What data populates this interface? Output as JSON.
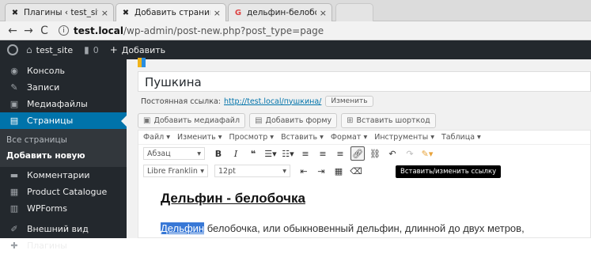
{
  "browser": {
    "tabs": [
      {
        "title": "Плагины ‹ test_site — W",
        "icon": "wordpress-icon",
        "active": false
      },
      {
        "title": "Добавить страницу ‹ te:",
        "icon": "wordpress-icon",
        "active": true
      },
      {
        "title": "дельфин-белобочка - П",
        "icon": "google-icon",
        "active": false
      }
    ],
    "close_glyph": "×",
    "url_host": "test.local",
    "url_path": "/wp-admin/post-new.php?post_type=page"
  },
  "adminbar": {
    "site_name": "test_site",
    "comments_count": "0",
    "add_label": "Добавить"
  },
  "sidebar": {
    "items": [
      {
        "label": "Консоль",
        "icon": "dashboard-icon"
      },
      {
        "label": "Записи",
        "icon": "pin-icon"
      },
      {
        "label": "Медиафайлы",
        "icon": "media-icon"
      },
      {
        "label": "Страницы",
        "icon": "pages-icon",
        "current": true
      }
    ],
    "submenu": [
      {
        "label": "Все страницы"
      },
      {
        "label": "Добавить новую",
        "current": true
      }
    ],
    "items_after": [
      {
        "label": "Комментарии",
        "icon": "comments-icon"
      },
      {
        "label": "Product Catalogue",
        "icon": "catalog-icon"
      },
      {
        "label": "WPForms",
        "icon": "forms-icon"
      },
      {
        "label": "Внешний вид",
        "icon": "brush-icon"
      },
      {
        "label": "Плагины",
        "icon": "plugins-icon"
      }
    ]
  },
  "editor": {
    "title_value": "Пушкина",
    "permalink_label": "Постоянная ссылка:",
    "permalink_url": "http://test.local/пушкина/",
    "permalink_edit": "Изменить",
    "media_buttons": [
      {
        "label": "Добавить медиафайл",
        "icon": "media-add-icon"
      },
      {
        "label": "Добавить форму",
        "icon": "form-icon"
      },
      {
        "label": "Вставить шорткод",
        "icon": "shortcode-icon"
      }
    ],
    "menu": [
      "Файл ▾",
      "Изменить ▾",
      "Просмотр ▾",
      "Вставить ▾",
      "Формат ▾",
      "Инструменты ▾",
      "Таблица ▾"
    ],
    "format_select": "Абзац",
    "font_select": "Libre Franklin",
    "size_select": "12pt",
    "tooltip": "Вставить/изменить ссылку",
    "heading": "Дельфин - белобочка",
    "para_highlight": "Дельфин",
    "para_rest": " белобочка, или обыкновенный дельфин, длинной до двух метров,"
  },
  "colors": {
    "sidebar_bg": "#23282d",
    "accent": "#0073aa",
    "selection": "#3878d6"
  }
}
